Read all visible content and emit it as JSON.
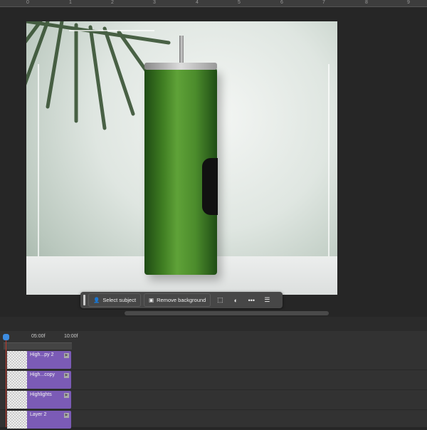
{
  "ruler": {
    "ticks": [
      "0",
      "1",
      "2",
      "3",
      "4",
      "5",
      "6",
      "7",
      "8",
      "9"
    ]
  },
  "taskbar": {
    "select_subject": "Select subject",
    "remove_background": "Remove background"
  },
  "timeline": {
    "time_labels": [
      "05:00f",
      "10:00f"
    ],
    "layers": [
      {
        "name": "High...py 2"
      },
      {
        "name": "High...copy"
      },
      {
        "name": "Highlights"
      },
      {
        "name": "Layer 2"
      }
    ]
  }
}
